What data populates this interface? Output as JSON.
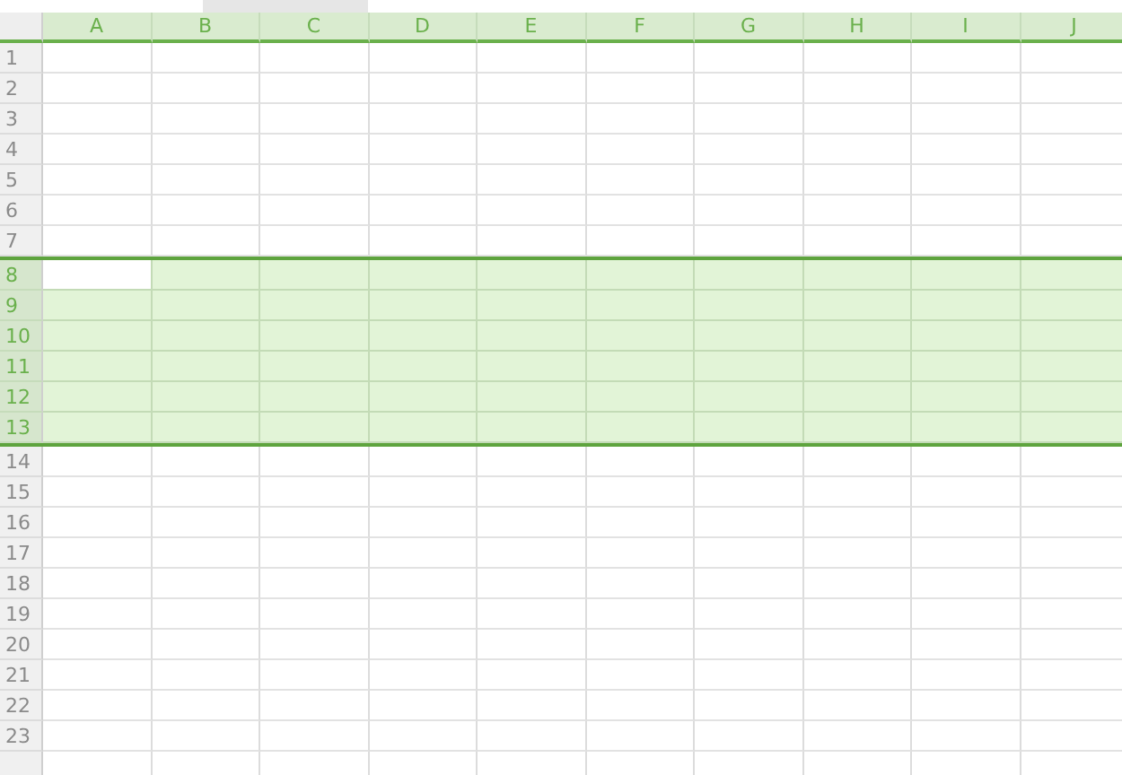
{
  "columns": [
    {
      "label": "A"
    },
    {
      "label": "B"
    },
    {
      "label": "C"
    },
    {
      "label": "D"
    },
    {
      "label": "E"
    },
    {
      "label": "F"
    },
    {
      "label": "G"
    },
    {
      "label": "H"
    },
    {
      "label": "I"
    },
    {
      "label": "J"
    }
  ],
  "rows": [
    {
      "label": "1",
      "selected": false,
      "active": false
    },
    {
      "label": "2",
      "selected": false,
      "active": false
    },
    {
      "label": "3",
      "selected": false,
      "active": false
    },
    {
      "label": "4",
      "selected": false,
      "active": false
    },
    {
      "label": "5",
      "selected": false,
      "active": false
    },
    {
      "label": "6",
      "selected": false,
      "active": false
    },
    {
      "label": "7",
      "selected": false,
      "active": false
    },
    {
      "label": "8",
      "selected": true,
      "active": true
    },
    {
      "label": "9",
      "selected": true,
      "active": false
    },
    {
      "label": "10",
      "selected": true,
      "active": false
    },
    {
      "label": "11",
      "selected": true,
      "active": false
    },
    {
      "label": "12",
      "selected": true,
      "active": false
    },
    {
      "label": "13",
      "selected": true,
      "active": false
    },
    {
      "label": "14",
      "selected": false,
      "active": false
    },
    {
      "label": "15",
      "selected": false,
      "active": false
    },
    {
      "label": "16",
      "selected": false,
      "active": false
    },
    {
      "label": "17",
      "selected": false,
      "active": false
    },
    {
      "label": "18",
      "selected": false,
      "active": false
    },
    {
      "label": "19",
      "selected": false,
      "active": false
    },
    {
      "label": "20",
      "selected": false,
      "active": false
    },
    {
      "label": "21",
      "selected": false,
      "active": false
    },
    {
      "label": "22",
      "selected": false,
      "active": false
    },
    {
      "label": "23",
      "selected": false,
      "active": false
    }
  ]
}
